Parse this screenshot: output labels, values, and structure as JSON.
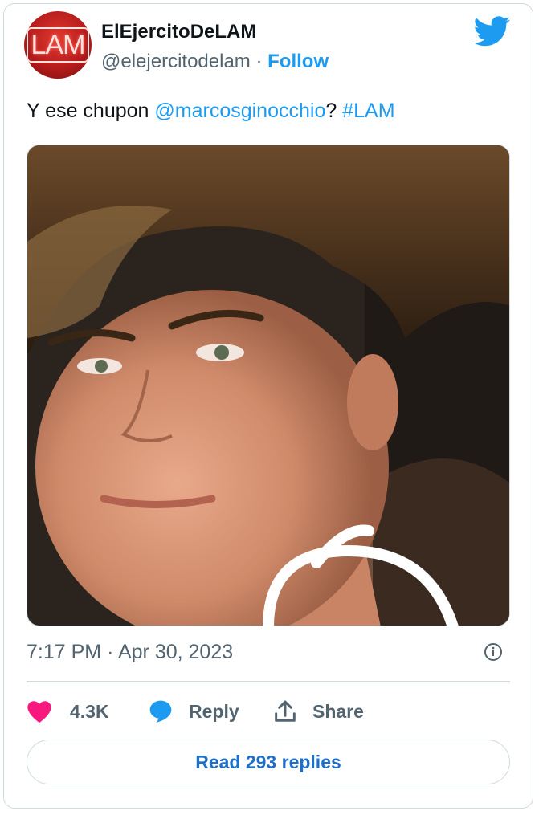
{
  "author": {
    "avatar_text": "LAM",
    "display_name": "ElEjercitoDeLAM",
    "handle": "@elejercitodelam",
    "separator": "·",
    "follow_label": "Follow"
  },
  "tweet": {
    "text_before": "Y ese chupon ",
    "mention": "@marcosginocchio",
    "text_middle": "? ",
    "hashtag": "#LAM"
  },
  "meta": {
    "time": "7:17 PM",
    "separator": "·",
    "date": "Apr 30, 2023"
  },
  "actions": {
    "like_count": "4.3K",
    "reply_label": "Reply",
    "share_label": "Share"
  },
  "read_replies_label": "Read 293 replies",
  "colors": {
    "accent": "#1d9bf0",
    "like": "#f91880",
    "muted": "#536471",
    "border": "#cfd9de"
  }
}
